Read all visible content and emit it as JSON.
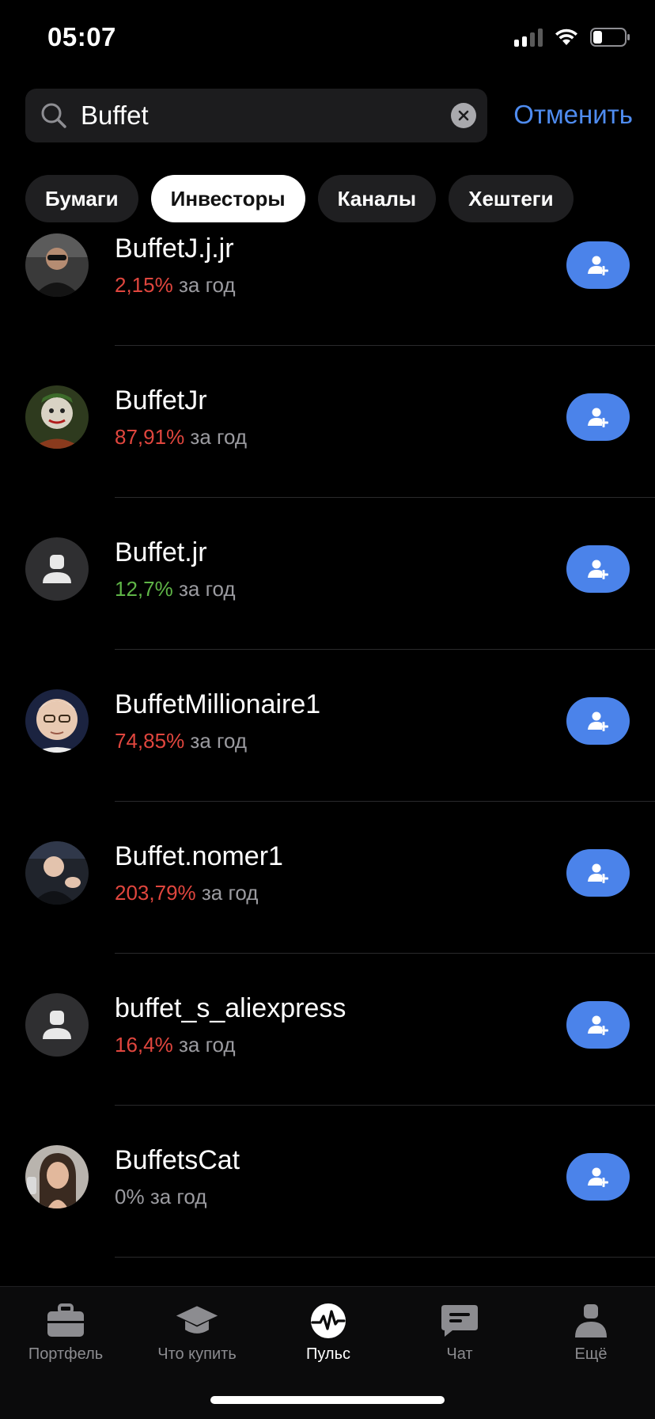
{
  "status_bar": {
    "time": "05:07",
    "icons": [
      "cellular-signal-icon",
      "wifi-icon",
      "battery-icon"
    ]
  },
  "search": {
    "value": "Buffet",
    "placeholder": "",
    "cancel_label": "Отменить"
  },
  "filters": [
    {
      "label": "Бумаги",
      "active": false
    },
    {
      "label": "Инвесторы",
      "active": true
    },
    {
      "label": "Каналы",
      "active": false
    },
    {
      "label": "Хештеги",
      "active": false
    }
  ],
  "investors": [
    {
      "name": "BuffetJ.j.jr",
      "return": "2,15%",
      "period": "за год",
      "return_color": "red",
      "avatar": "photo-man-sunglasses"
    },
    {
      "name": "BuffetJr",
      "return": "87,91%",
      "period": "за год",
      "return_color": "red",
      "avatar": "photo-joker"
    },
    {
      "name": "Buffet.jr",
      "return": "12,7%",
      "period": "за год",
      "return_color": "green",
      "avatar": "default-user-icon"
    },
    {
      "name": "BuffetMillionaire1",
      "return": "74,85%",
      "period": "за год",
      "return_color": "red",
      "avatar": "photo-older-man-glasses"
    },
    {
      "name": "Buffet.nomer1",
      "return": "203,79%",
      "period": "за год",
      "return_color": "red",
      "avatar": "photo-man-applauding"
    },
    {
      "name": "buffet_s_aliexpress",
      "return": "16,4%",
      "period": "за год",
      "return_color": "red",
      "avatar": "default-user-icon"
    },
    {
      "name": "BuffetsCat",
      "return": "0%",
      "period": "за год",
      "return_color": "gray",
      "avatar": "photo-woman"
    }
  ],
  "tab_bar": [
    {
      "label": "Портфель",
      "icon": "briefcase-icon",
      "active": false
    },
    {
      "label": "Что купить",
      "icon": "graduation-cap-icon",
      "active": false
    },
    {
      "label": "Пульс",
      "icon": "pulse-icon",
      "active": true
    },
    {
      "label": "Чат",
      "icon": "chat-icon",
      "active": false
    },
    {
      "label": "Ещё",
      "icon": "more-user-icon",
      "active": false
    }
  ],
  "colors": {
    "accent": "#4b83ea",
    "link": "#4f8cf0",
    "negative": "#e0463e",
    "positive": "#5fb547"
  }
}
